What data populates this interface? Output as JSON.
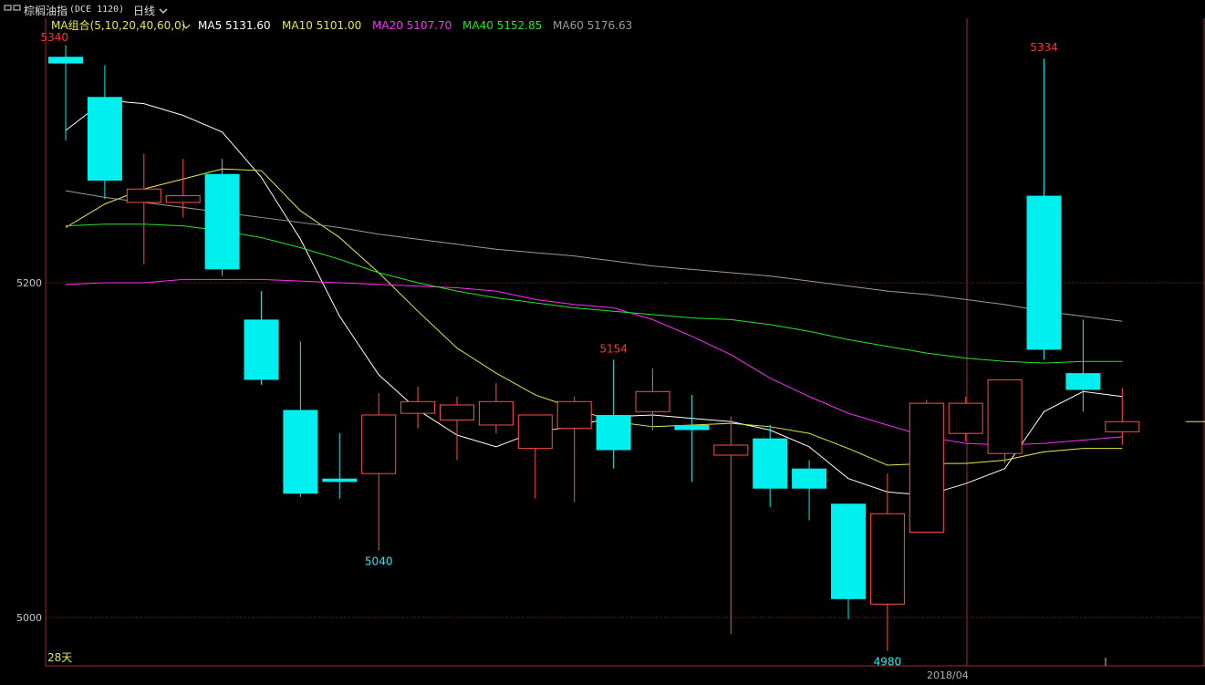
{
  "toolbar": {
    "window_icon": "window-icon",
    "instrument": "棕榈油指",
    "code": "(DCE 1120)",
    "period": "日线",
    "chevron_icon": "chevron-down-icon"
  },
  "ma_legend": {
    "group_label": "MA组合(5,10,20,40,60,0)",
    "items": [
      {
        "label": "MA5 5131.60",
        "color": "#ffffff"
      },
      {
        "label": "MA10 5101.00",
        "color": "#e8e84a"
      },
      {
        "label": "MA20 5107.70",
        "color": "#ff2bff"
      },
      {
        "label": "MA40 5152.85",
        "color": "#27e627"
      },
      {
        "label": "MA60 5176.63",
        "color": "#9a9a9a"
      }
    ]
  },
  "footer": {
    "days_label": "28天",
    "date_label": "2018/04"
  },
  "colors": {
    "up": "#ff4d4d",
    "down": "#00f0f0",
    "grid": "#8b1a1a",
    "axis": "#a52a2a",
    "label_high": "#ff3333",
    "label_low": "#33e6e6"
  },
  "chart_data": {
    "type": "candlestick",
    "ylim": [
      4980,
      5340
    ],
    "y_ticks": [
      5000,
      5200
    ],
    "y_tick_labels": [
      "5000",
      "5200"
    ],
    "candles": [
      {
        "o": 5335,
        "h": 5342,
        "l": 5285,
        "c": 5331
      },
      {
        "o": 5311,
        "h": 5330,
        "l": 5250,
        "c": 5261
      },
      {
        "o": 5248,
        "h": 5277,
        "l": 5211,
        "c": 5256
      },
      {
        "o": 5248,
        "h": 5274,
        "l": 5239,
        "c": 5252
      },
      {
        "o": 5265,
        "h": 5274,
        "l": 5204,
        "c": 5208
      },
      {
        "o": 5178,
        "h": 5195,
        "l": 5139,
        "c": 5142
      },
      {
        "o": 5124,
        "h": 5165,
        "l": 5072,
        "c": 5074
      },
      {
        "o": 5083,
        "h": 5110,
        "l": 5071,
        "c": 5081
      },
      {
        "o": 5086,
        "h": 5134,
        "l": 5040,
        "c": 5121
      },
      {
        "o": 5122,
        "h": 5138,
        "l": 5113,
        "c": 5129
      },
      {
        "o": 5118,
        "h": 5132,
        "l": 5094,
        "c": 5127
      },
      {
        "o": 5115,
        "h": 5140,
        "l": 5110,
        "c": 5129
      },
      {
        "o": 5101,
        "h": 5120,
        "l": 5071,
        "c": 5121
      },
      {
        "o": 5113,
        "h": 5132,
        "l": 5069,
        "c": 5129
      },
      {
        "o": 5121,
        "h": 5154,
        "l": 5089,
        "c": 5100
      },
      {
        "o": 5123,
        "h": 5149,
        "l": 5112,
        "c": 5135
      },
      {
        "o": 5115,
        "h": 5133,
        "l": 5081,
        "c": 5112
      },
      {
        "o": 5097,
        "h": 5120,
        "l": 4990,
        "c": 5103
      },
      {
        "o": 5107,
        "h": 5115,
        "l": 5066,
        "c": 5077
      },
      {
        "o": 5089,
        "h": 5094,
        "l": 5058,
        "c": 5077
      },
      {
        "o": 5068,
        "h": 5068,
        "l": 4999,
        "c": 5011
      },
      {
        "o": 5008,
        "h": 5086,
        "l": 4980,
        "c": 5062
      },
      {
        "o": 5051,
        "h": 5130,
        "l": 5051,
        "c": 5128
      },
      {
        "o": 5110,
        "h": 5132,
        "l": 5105,
        "c": 5128
      },
      {
        "o": 5098,
        "h": 5140,
        "l": 5092,
        "c": 5142
      },
      {
        "o": 5252,
        "h": 5334,
        "l": 5154,
        "c": 5160
      },
      {
        "o": 5146,
        "h": 5178,
        "l": 5123,
        "c": 5136
      },
      {
        "o": 5111,
        "h": 5137,
        "l": 5103,
        "c": 5117
      }
    ],
    "ma_series": [
      {
        "name": "MA5",
        "values": [
          5291,
          5309,
          5307,
          5300,
          5290,
          5263,
          5226,
          5180,
          5145,
          5124,
          5109,
          5102,
          5111,
          5114,
          5120,
          5121,
          5119,
          5117,
          5112,
          5102,
          5083,
          5075,
          5073,
          5080,
          5089,
          5123,
          5135,
          5132
        ]
      },
      {
        "name": "MA10",
        "values": [
          5233,
          5247,
          5256,
          5262,
          5268,
          5267,
          5243,
          5227,
          5206,
          5183,
          5161,
          5146,
          5133,
          5125,
          5117,
          5114,
          5115,
          5116,
          5114,
          5110,
          5101,
          5091,
          5092,
          5092,
          5094,
          5099,
          5101,
          5101
        ]
      },
      {
        "name": "MA20",
        "values": [
          5199,
          5200,
          5200,
          5202,
          5202,
          5202,
          5201,
          5200,
          5199,
          5198,
          5197,
          5195,
          5190,
          5187,
          5185,
          5178,
          5168,
          5157,
          5143,
          5132,
          5122,
          5115,
          5108,
          5104,
          5103,
          5104,
          5106,
          5108
        ]
      },
      {
        "name": "MA40",
        "values": [
          5234,
          5235,
          5235,
          5234,
          5231,
          5227,
          5221,
          5214,
          5206,
          5200,
          5195,
          5191,
          5188,
          5185,
          5183,
          5181,
          5179,
          5178,
          5175,
          5171,
          5166,
          5162,
          5158,
          5155,
          5153,
          5152,
          5153,
          5153
        ]
      },
      {
        "name": "MA60",
        "values": [
          5255,
          5251,
          5248,
          5245,
          5242,
          5239,
          5236,
          5233,
          5229,
          5226,
          5223,
          5220,
          5218,
          5216,
          5213,
          5210,
          5208,
          5206,
          5204,
          5201,
          5198,
          5195,
          5193,
          5190,
          5187,
          5183,
          5180,
          5177
        ]
      }
    ],
    "annotations": [
      {
        "text": "5340",
        "index": 0,
        "value": 5340,
        "kind": "high"
      },
      {
        "text": "5334",
        "index": 25,
        "value": 5334,
        "kind": "high"
      },
      {
        "text": "5154",
        "index": 14,
        "value": 5154,
        "kind": "high"
      },
      {
        "text": "5040",
        "index": 8,
        "value": 5040,
        "kind": "low"
      },
      {
        "text": "4980",
        "index": 21,
        "value": 4980,
        "kind": "low"
      }
    ],
    "last_price": 5117,
    "grid": true
  }
}
